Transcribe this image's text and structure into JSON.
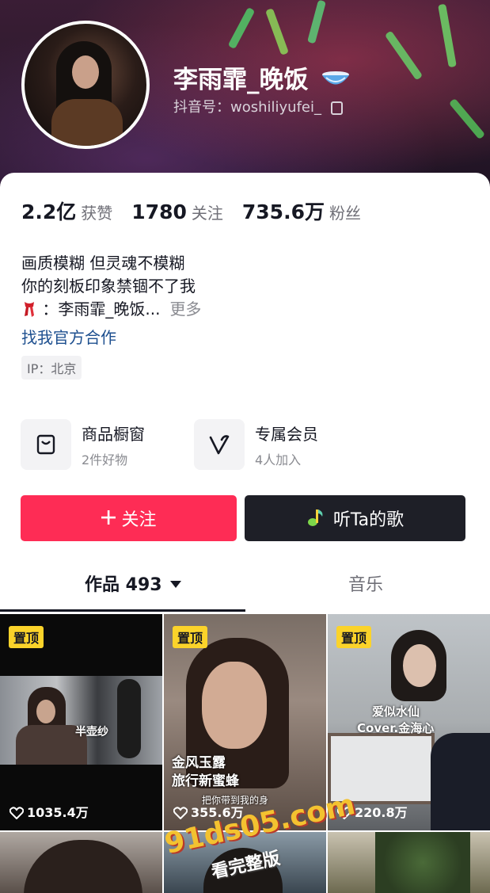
{
  "profile": {
    "name": "李雨霏_晚饭",
    "douyin_id": "抖音号：woshiliyufei_",
    "stats": [
      {
        "value": "2.2亿",
        "label": "获赞"
      },
      {
        "value": "1780",
        "label": "关注"
      },
      {
        "value": "735.6万",
        "label": "粉丝"
      }
    ],
    "bio": {
      "line1": "画质模糊 但灵魂不模糊",
      "line2": "你的刻板印象禁锢不了我",
      "line3": "：李雨霏_晚饭...",
      "more": "更多"
    },
    "cooperate": "找我官方合作",
    "ip": "IP：北京"
  },
  "features": [
    {
      "title": "商品橱窗",
      "subtitle": "2件好物",
      "icon": "shopping-bag-icon"
    },
    {
      "title": "专属会员",
      "subtitle": "4人加入",
      "icon": "vip-v-icon"
    }
  ],
  "buttons": {
    "follow": "关注",
    "follow_icon": "plus-icon",
    "listen": "听Ta的歌",
    "listen_icon": "music-note-icon"
  },
  "tabs": {
    "works": "作品 493",
    "music": "音乐"
  },
  "videos": [
    {
      "pinned": "置顶",
      "likes": "1035.4万",
      "caption": "半壶纱"
    },
    {
      "pinned": "置顶",
      "likes": "355.6万",
      "caption_line1": "金风玉露",
      "caption_line2": "旅行新蜜蜂",
      "subcaption": "把你带到我的身"
    },
    {
      "pinned": "置顶",
      "likes": "220.8万",
      "caption_line1": "爱似水仙",
      "caption_line2": "Cover.金海心"
    }
  ],
  "watermark": {
    "site": "91ds05.com",
    "text": "看完整版"
  },
  "colors": {
    "accent": "#fe2c55",
    "dark_button": "#1e1f27",
    "pinned_badge": "#fbd32a",
    "link": "#1d4f8f"
  }
}
